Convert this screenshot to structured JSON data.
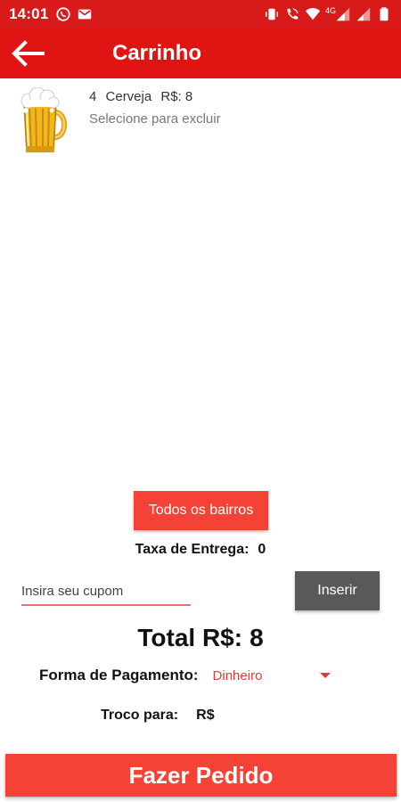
{
  "status_bar": {
    "time": "14:01",
    "network": "4G",
    "icons": [
      "whatsapp-icon",
      "gmail-icon",
      "vibrate-icon",
      "wifi-call-icon",
      "wifi-icon",
      "signal-icon",
      "signal-icon",
      "battery-icon"
    ],
    "bg_color": "#d91a1a"
  },
  "app_bar": {
    "title": "Carrinho",
    "back_icon": "arrow-back-icon",
    "bg_color": "#e11414"
  },
  "cart": {
    "items": [
      {
        "quantity": "4",
        "name": "Cerveja",
        "price": "R$: 8",
        "hint": "Selecione para excluir",
        "icon": "beer-mug-icon"
      }
    ]
  },
  "delivery": {
    "neighborhoods_button": "Todos os bairros",
    "fee_label": "Taxa de Entrega:",
    "fee_value": "0"
  },
  "coupon": {
    "placeholder": "Insira seu cupom",
    "value": "",
    "insert_button": "Inserir"
  },
  "total": {
    "label": "Total R$:",
    "value": "8"
  },
  "payment": {
    "label": "Forma de Pagamento:",
    "selected": "Dinheiro"
  },
  "change": {
    "label": "Troco para:",
    "currency": "R$"
  },
  "order_button": "Fazer Pedido",
  "colors": {
    "accent": "#f44336",
    "dark_button": "#595959",
    "select_text": "#e53935"
  }
}
